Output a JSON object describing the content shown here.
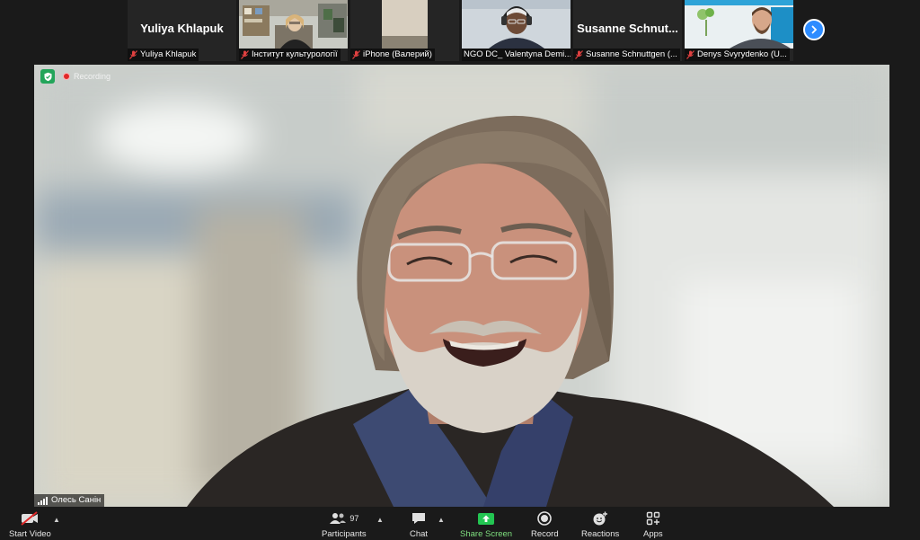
{
  "participants_strip": {
    "tiles": [
      {
        "big_name": "Yuliya Khlapuk",
        "label": "Yuliya Khlapuk"
      },
      {
        "big_name": "",
        "label": "Інститут культурології"
      },
      {
        "big_name": "",
        "label": "iPhone (Валерий)"
      },
      {
        "big_name": "",
        "label": "NGO DC_ Valentyna Demi..."
      },
      {
        "big_name": "Susanne  Schnut...",
        "label": "Susanne Schnuttgen (..."
      },
      {
        "big_name": "",
        "label": "Denys Svyrydenko (U..."
      }
    ]
  },
  "meeting": {
    "recording_label": "Recording",
    "speaker_name": "Олесь Санін"
  },
  "toolbar": {
    "start_video": "Start Video",
    "participants": "Participants",
    "participants_count": "97",
    "chat": "Chat",
    "share_screen": "Share Screen",
    "record": "Record",
    "reactions": "Reactions",
    "apps": "Apps"
  },
  "colors": {
    "accent_blue": "#2d8cff",
    "share_green": "#23c552",
    "recording_red": "#e02828",
    "security_green": "#23a55a"
  }
}
